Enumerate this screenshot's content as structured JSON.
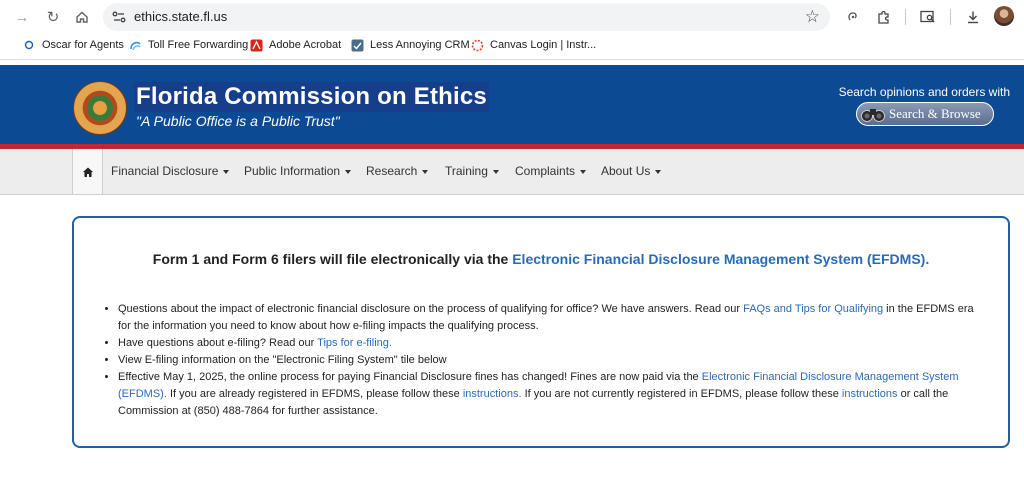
{
  "browser": {
    "url": "ethics.state.fl.us",
    "bookmarks": [
      {
        "label": "Oscar for Agents",
        "icon": "circle-icon"
      },
      {
        "label": "Toll Free Forwarding",
        "icon": "swirl-icon"
      },
      {
        "label": "Adobe Acrobat",
        "icon": "acrobat-icon"
      },
      {
        "label": "Less Annoying CRM",
        "icon": "crm-icon"
      },
      {
        "label": "Canvas Login | Instr...",
        "icon": "canvas-icon"
      }
    ]
  },
  "site": {
    "title": "Florida Commission on Ethics",
    "motto": "\"A Public Office is a Public Trust\"",
    "search_label": "Search opinions and orders with",
    "search_button": "Search & Browse"
  },
  "nav": {
    "items": [
      "Financial Disclosure",
      "Public Information",
      "Research",
      "Training",
      "Complaints",
      "About Us"
    ]
  },
  "notice": {
    "title_text": "Form 1 and Form 6 filers will file electronically via the ",
    "title_link": "Electronic Financial Disclosure Management System (EFDMS).",
    "b1_text1": "Questions about the impact of electronic financial disclosure on the process of qualifying for office? We have answers. Read our ",
    "b1_link": "FAQs and Tips for Qualifying",
    "b1_text2": " in the EFDMS era for the information you need to know about how e-filing impacts the qualifying process.",
    "b2_text": "Have questions about e-filing? Read our ",
    "b2_link": "Tips for e-filing.",
    "b3_text": "View E-filing information on the \"Electronic Filing System\" tile below",
    "b4_text1": "Effective May 1, 2025, the online process for paying Financial Disclosure fines has changed! Fines are now paid via the ",
    "b4_link1": "Electronic Financial Disclosure Management System (EFDMS).",
    "b4_text2": " If you are already registered in EFDMS, please follow these ",
    "b4_link2": "instructions.",
    "b4_text3": " If you are not currently registered in EFDMS, please follow these ",
    "b4_link3": "instructions",
    "b4_text4": " or call the Commission at (850) 488-7864 for further assistance."
  }
}
